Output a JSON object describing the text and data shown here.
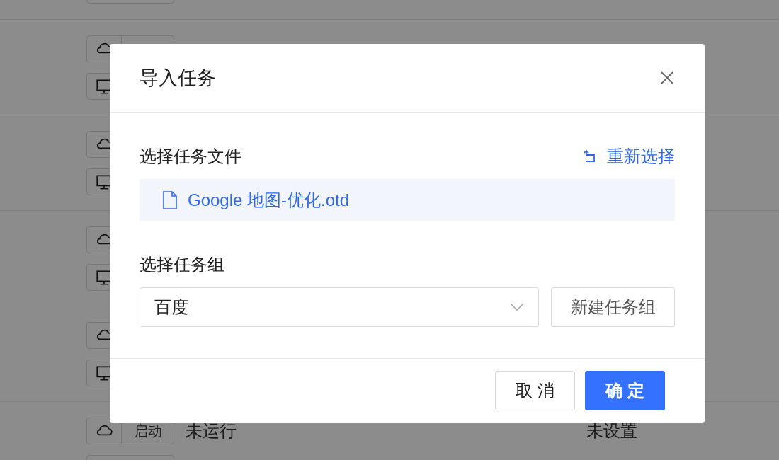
{
  "task_rows": [
    {
      "kind": "partial"
    },
    {
      "kind": "covered"
    },
    {
      "kind": "covered"
    },
    {
      "kind": "covered"
    },
    {
      "kind": "covered"
    },
    {
      "kind": "visible",
      "start_label": "启动",
      "status": "未运行",
      "schedule": "未设置"
    }
  ],
  "dialog": {
    "title": "导入任务",
    "file_section": {
      "label": "选择任务文件",
      "reselect_link": "重新选择",
      "file_name": "Google 地图-优化.otd"
    },
    "group_section": {
      "label": "选择任务组",
      "selected_group": "百度",
      "new_group_button": "新建任务组"
    },
    "buttons": [
      {
        "label": "取 消",
        "kind": "secondary"
      },
      {
        "label": "确 定",
        "kind": "primary"
      }
    ]
  }
}
